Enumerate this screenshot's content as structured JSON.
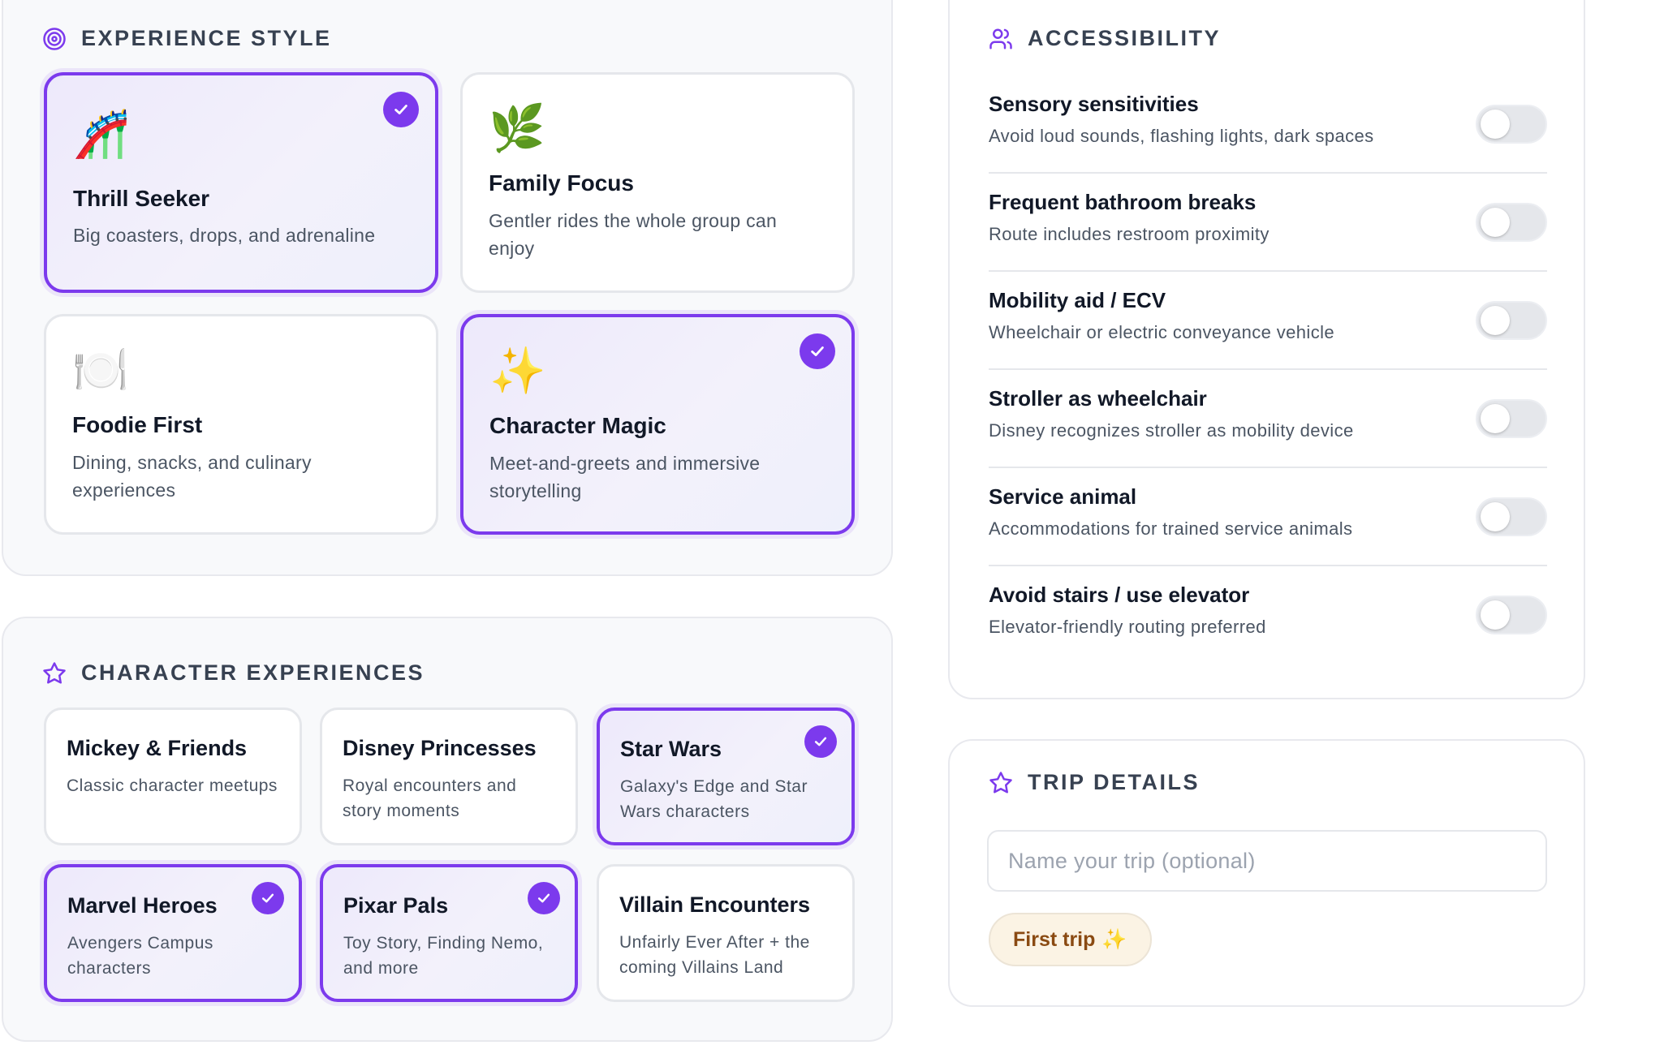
{
  "experience_style": {
    "title": "EXPERIENCE STYLE",
    "icon": "target-icon",
    "cards": [
      {
        "emoji": "🎢",
        "title": "Thrill Seeker",
        "description": "Big coasters, drops, and adrenaline",
        "selected": true
      },
      {
        "emoji": "🌿",
        "title": "Family Focus",
        "description": "Gentler rides the whole group can enjoy",
        "selected": false
      },
      {
        "emoji": "🍽️",
        "title": "Foodie First",
        "description": "Dining, snacks, and culinary experiences",
        "selected": false
      },
      {
        "emoji": "✨",
        "title": "Character Magic",
        "description": "Meet-and-greets and immersive storytelling",
        "selected": true
      }
    ]
  },
  "character_experiences": {
    "title": "CHARACTER EXPERIENCES",
    "icon": "star-icon",
    "cards": [
      {
        "title": "Mickey & Friends",
        "description": "Classic character meetups",
        "selected": false
      },
      {
        "title": "Disney Princesses",
        "description": "Royal encounters and story moments",
        "selected": false
      },
      {
        "title": "Star Wars",
        "description": "Galaxy's Edge and Star Wars characters",
        "selected": true
      },
      {
        "title": "Marvel Heroes",
        "description": "Avengers Campus characters",
        "selected": true
      },
      {
        "title": "Pixar Pals",
        "description": "Toy Story, Finding Nemo, and more",
        "selected": true
      },
      {
        "title": "Villain Encounters",
        "description": "Unfairly Ever After + the coming Villains Land",
        "selected": false
      }
    ]
  },
  "accessibility": {
    "title": "ACCESSIBILITY",
    "icon": "users-icon",
    "options": [
      {
        "title": "Sensory sensitivities",
        "description": "Avoid loud sounds, flashing lights, dark spaces",
        "enabled": false
      },
      {
        "title": "Frequent bathroom breaks",
        "description": "Route includes restroom proximity",
        "enabled": false
      },
      {
        "title": "Mobility aid / ECV",
        "description": "Wheelchair or electric conveyance vehicle",
        "enabled": false
      },
      {
        "title": "Stroller as wheelchair",
        "description": "Disney recognizes stroller as mobility device",
        "enabled": false
      },
      {
        "title": "Service animal",
        "description": "Accommodations for trained service animals",
        "enabled": false
      },
      {
        "title": "Avoid stairs / use elevator",
        "description": "Elevator-friendly routing preferred",
        "enabled": false
      }
    ]
  },
  "trip_details": {
    "title": "TRIP DETAILS",
    "icon": "star-icon",
    "name_input": {
      "value": "",
      "placeholder": "Name your trip (optional)"
    },
    "first_trip_chip": {
      "label": "First trip",
      "emoji": "✨"
    }
  },
  "colors": {
    "accent": "#7c3aed",
    "chip_bg": "#fbf3e4",
    "chip_text": "#8a4a12"
  }
}
